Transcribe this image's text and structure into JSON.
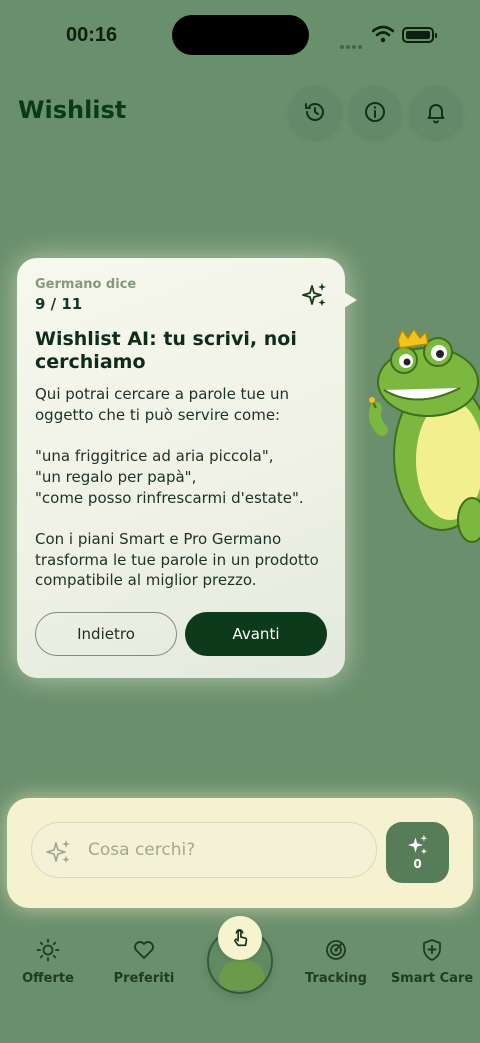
{
  "status_bar": {
    "time": "00:16"
  },
  "header": {
    "title": "Wishlist",
    "buttons": [
      "history-icon",
      "info-icon",
      "bell-icon"
    ]
  },
  "tooltip": {
    "kicker": "Germano dice",
    "step": "9 / 11",
    "title": "Wishlist AI: tu scrivi, noi cerchiamo",
    "body": "Qui potrai cercare a parole tue un oggetto che ti può servire come:\n\n\"una friggitrice ad aria piccola\",\n\"un regalo per papà\",\n\"come posso rinfrescarmi d'estate\".\n\nCon i piani Smart e Pro Germano trasforma le tue parole in un prodotto compatibile al miglior prezzo.",
    "back_label": "Indietro",
    "next_label": "Avanti"
  },
  "search": {
    "placeholder": "Cosa cerchi?",
    "ai_count": "0"
  },
  "tabbar": {
    "items": [
      {
        "label": "Offerte",
        "icon": "sun-icon"
      },
      {
        "label": "Preferiti",
        "icon": "heart-icon"
      },
      {
        "label": "Tracking",
        "icon": "radar-icon"
      },
      {
        "label": "Smart Care",
        "icon": "shield-plus-icon"
      }
    ]
  },
  "colors": {
    "background": "#6a8f6c",
    "primary": "#0d3a1b",
    "card": "#f3f5ea",
    "search_panel": "#f6f2cf"
  }
}
